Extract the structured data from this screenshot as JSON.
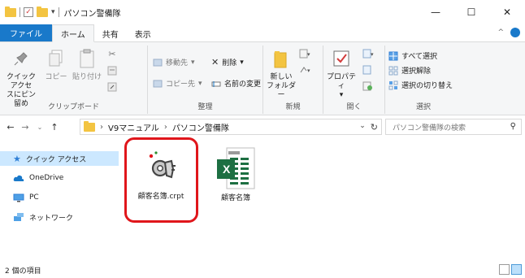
{
  "window": {
    "title": "パソコン警備隊",
    "minimize": "—",
    "maximize": "☐",
    "close": "✕"
  },
  "tabs": [
    {
      "label": "ファイル"
    },
    {
      "label": "ホーム"
    },
    {
      "label": "共有"
    },
    {
      "label": "表示"
    }
  ],
  "ribbon": {
    "clipboard": {
      "pin_label_1": "クイック アクセ",
      "pin_label_2": "スにピン留め",
      "copy": "コピー",
      "paste": "貼り付け",
      "group": "クリップボード"
    },
    "organize": {
      "move_to": "移動先",
      "copy_to": "コピー先",
      "delete": "削除",
      "rename": "名前の変更",
      "group": "整理"
    },
    "new": {
      "new_folder_1": "新しい",
      "new_folder_2": "フォルダー",
      "group": "新規"
    },
    "open": {
      "properties": "プロパティ",
      "group": "開く"
    },
    "select": {
      "select_all": "すべて選択",
      "select_none": "選択解除",
      "invert": "選択の切り替え",
      "group": "選択"
    }
  },
  "address": {
    "crumb_1": "V9マニュアル",
    "crumb_2": "パソコン警備隊",
    "search_placeholder": "パソコン警備隊の検索"
  },
  "nav": [
    {
      "label": "クイック アクセス"
    },
    {
      "label": "OneDrive"
    },
    {
      "label": "PC"
    },
    {
      "label": "ネットワーク"
    }
  ],
  "files": [
    {
      "name": "顧客名簿.crpt",
      "icon": "encrypted-key-icon"
    },
    {
      "name": "顧客名簿",
      "icon": "excel-icon"
    }
  ],
  "status": {
    "count": "2 個の項目"
  },
  "colors": {
    "accent": "#1979ca",
    "highlight": "#e0161b",
    "excel": "#1d6f42"
  }
}
